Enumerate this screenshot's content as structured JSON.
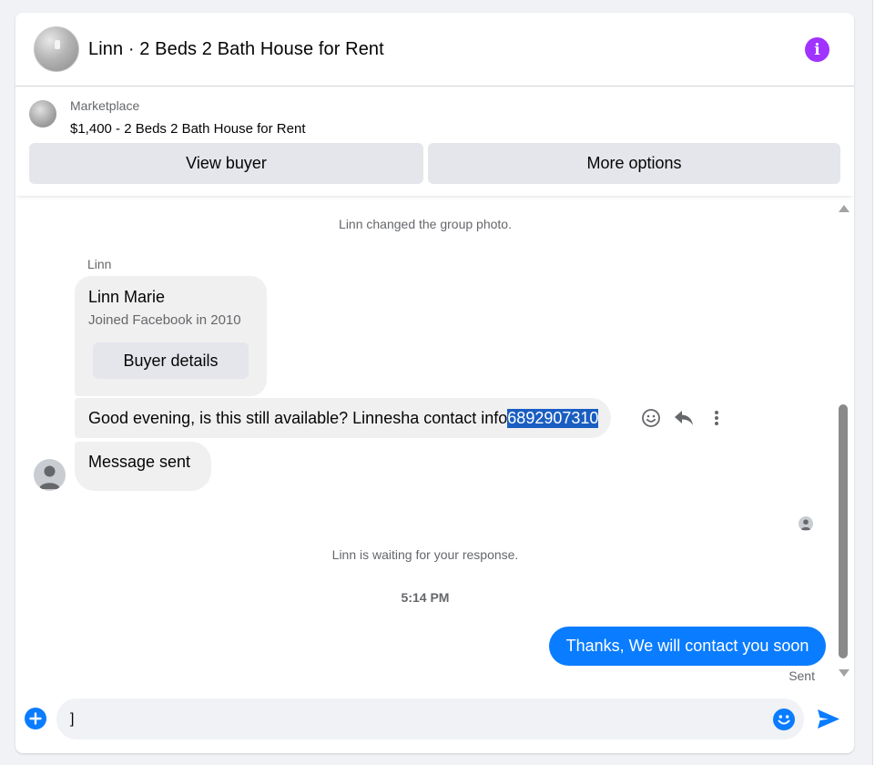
{
  "header": {
    "title": "Linn · 2 Beds 2 Bath House for Rent",
    "info_icon": "info-icon"
  },
  "listing": {
    "source": "Marketplace",
    "price_title": "$1,400 - 2 Beds 2 Bath House for Rent",
    "view_buyer_label": "View buyer",
    "more_options_label": "More options"
  },
  "messages": {
    "cut_off_text": "Linn changed the group photo.",
    "group_photo_notice": "Linn changed the group photo.",
    "sender_name": "Linn",
    "profile_card": {
      "name": "Linn Marie",
      "joined": "Joined Facebook in 2010",
      "button_label": "Buyer details"
    },
    "inquiry": {
      "text": "Good evening, is this still available? Linnesha contact info ",
      "highlighted": "6892907310"
    },
    "auto_reply": "Message sent",
    "waiting_notice": "Linn is waiting for your response.",
    "timestamp": "5:14 PM",
    "my_reply": "Thanks, We will contact you soon",
    "status": "Sent"
  },
  "composer": {
    "value": "]",
    "icons": [
      "plus-icon",
      "emoji-icon",
      "send-icon"
    ]
  },
  "colors": {
    "accent": "#0a7cff",
    "info": "#a033ff",
    "selection": "#1a5ec2",
    "bubble": "#f0f0f0"
  }
}
